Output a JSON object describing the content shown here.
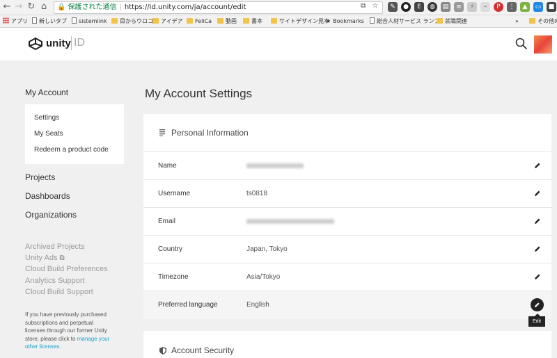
{
  "browser": {
    "secure_label": "保護された通信",
    "url": "https://id.unity.com/ja/account/edit",
    "bookmarks": [
      {
        "label": "アプリ",
        "icon": "apps-icon"
      },
      {
        "label": "新しいタブ",
        "icon": "page-icon"
      },
      {
        "label": "sistemlink",
        "icon": "page-icon"
      },
      {
        "label": "目からウロコ",
        "icon": "folder-icon"
      },
      {
        "label": "アイデア",
        "icon": "folder-icon"
      },
      {
        "label": "FeliCa",
        "icon": "folder-icon"
      },
      {
        "label": "動画",
        "icon": "folder-icon"
      },
      {
        "label": "書本",
        "icon": "folder-icon"
      },
      {
        "label": "サイトデザイン見本",
        "icon": "folder-icon"
      },
      {
        "label": "Bookmarks",
        "icon": "star-icon"
      },
      {
        "label": "総合人材サービス ランフ",
        "icon": "page-icon"
      },
      {
        "label": "就職関連",
        "icon": "folder-icon"
      },
      {
        "label": "その他の",
        "icon": "folder-icon"
      }
    ],
    "overflow_label": "»"
  },
  "header": {
    "logo_text": "unity",
    "logo_suffix": "ID"
  },
  "sidebar": {
    "title": "My Account",
    "sub_items": [
      "Settings",
      "My Seats",
      "Redeem a product code"
    ],
    "main_items": [
      "Projects",
      "Dashboards",
      "Organizations"
    ],
    "muted_items": [
      "Archived Projects",
      "Unity Ads",
      "Cloud Build Preferences",
      "Analytics Support",
      "Cloud Build Support"
    ],
    "note_lines": [
      "If you have previously purchased",
      "subscriptions and perpetual",
      "licenses through our former Unity",
      "store, please click to"
    ],
    "note_link_1": "manage your",
    "note_link_2": "other licenses",
    "note_end": "."
  },
  "main": {
    "page_title": "My Account Settings",
    "section_title": "Personal Information",
    "rows": [
      {
        "label": "Name",
        "value": ""
      },
      {
        "label": "Username",
        "value": "ts0818"
      },
      {
        "label": "Email",
        "value": ""
      },
      {
        "label": "Country",
        "value": "Japan, Tokyo"
      },
      {
        "label": "Timezone",
        "value": "Asia/Tokyo"
      },
      {
        "label": "Preferred language",
        "value": "English"
      }
    ],
    "tooltip": "Edit",
    "section2_title": "Account Security"
  }
}
